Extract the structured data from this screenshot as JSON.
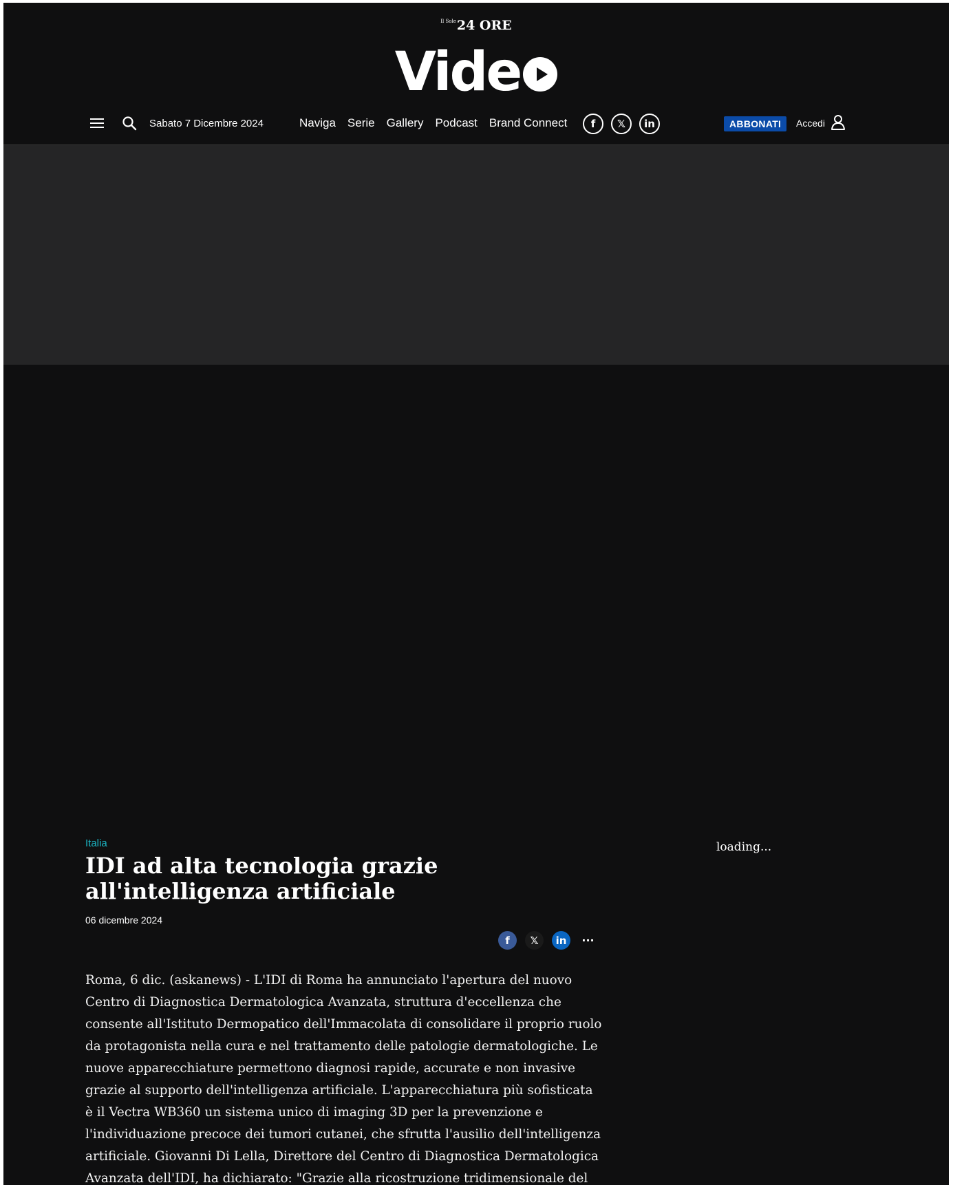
{
  "header": {
    "brand_small_prefix": "Il Sole",
    "brand_small": "24 ORE",
    "brand_video": "Vide",
    "date": "Sabato 7 Dicembre 2024",
    "nav": [
      "Naviga",
      "Serie",
      "Gallery",
      "Podcast",
      "Brand Connect"
    ],
    "social": {
      "facebook": "f",
      "x": "𝕏",
      "linkedin": "in"
    },
    "subscribe_label": "ABBONATI",
    "login_label": "Accedi",
    "subscribe_color": "#0b4ba8"
  },
  "icons": {
    "menu": "hamburger-icon",
    "search": "search-icon",
    "user": "user-icon",
    "play": "play-icon"
  },
  "article": {
    "category": "Italia",
    "title": "IDI ad alta tecnologia grazie all'intelligenza artificiale",
    "date": "06 dicembre 2024",
    "share": {
      "facebook": "f",
      "x": "𝕏",
      "linkedin": "in",
      "more": "···"
    },
    "body": "Roma, 6 dic. (askanews) - L'IDI di Roma ha annunciato l'apertura del nuovo Centro di Diagnostica Dermatologica Avanzata, struttura d'eccellenza che consente all'Istituto Dermopatico dell'Immacolata di consolidare il proprio ruolo da protagonista nella cura e nel trattamento delle patologie dermatologiche. Le nuove apparecchiature permettono diagnosi rapide, accurate e non invasive grazie al supporto dell'intelligenza artificiale. L'apparecchiatura più sofisticata è il Vectra WB360 un sistema unico di imaging 3D per la prevenzione e l'individuazione precoce dei tumori cutanei, che sfrutta l'ausilio dell'intelligenza artificiale. Giovanni Di Lella, Direttore del Centro di Diagnostica Dermatologica Avanzata dell'IDI, ha dichiarato: \"Grazie alla ricostruzione tridimensionale del",
    "category_color": "#1bb5c4"
  },
  "sidebar": {
    "loading_text": "loading..."
  }
}
